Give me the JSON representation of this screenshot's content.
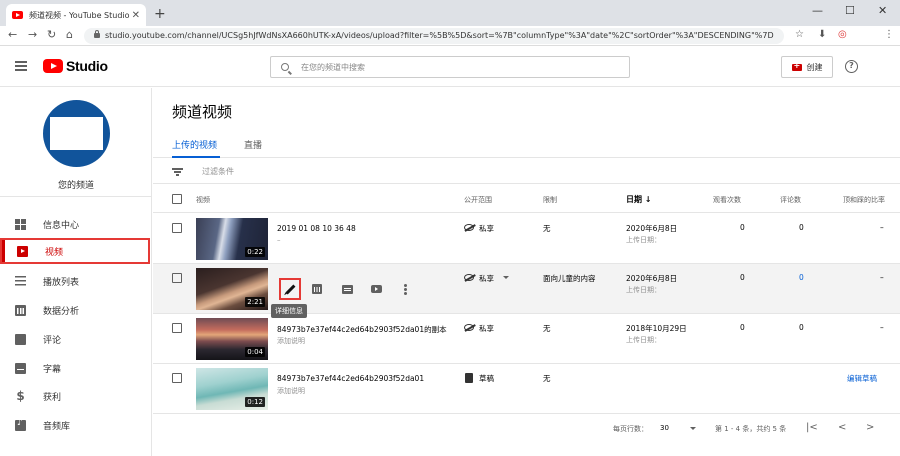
{
  "browser": {
    "tab_title": "频道视频 - YouTube Studio",
    "new_tab": "+",
    "url": "studio.youtube.com/channel/UCSg5hJfWdNsXA660hUTK-xA/videos/upload?filter=%5B%5D&sort=%7B\"columnType\"%3A\"date\"%2C\"sortOrder\"%3A\"DESCENDING\"%7D",
    "back": "←",
    "forward": "→",
    "reload": "↻",
    "home": "⌂",
    "minimize": "—",
    "maximize": "☐",
    "close": "✕",
    "star": "☆",
    "download": "⬇",
    "menu": "⋮"
  },
  "header": {
    "logo": "Studio",
    "search_placeholder": "在您的频道中搜索",
    "create_label": "创建",
    "help": "?"
  },
  "sidebar": {
    "channel_name": "您的频道",
    "items": [
      {
        "label": "信息中心",
        "icon": "dashboard-icon"
      },
      {
        "label": "视频",
        "icon": "video-icon",
        "active": true
      },
      {
        "label": "播放列表",
        "icon": "playlist-icon"
      },
      {
        "label": "数据分析",
        "icon": "analytics-icon"
      },
      {
        "label": "评论",
        "icon": "comment-icon"
      },
      {
        "label": "字幕",
        "icon": "subtitle-icon"
      },
      {
        "label": "获利",
        "icon": "dollar-icon"
      },
      {
        "label": "音频库",
        "icon": "audio-library-icon"
      }
    ]
  },
  "main": {
    "title": "频道视频",
    "tabs": [
      {
        "label": "上传的视频",
        "active": true
      },
      {
        "label": "直播"
      }
    ],
    "filter_placeholder": "过滤条件",
    "columns": {
      "video": "视频",
      "visibility": "公开范围",
      "restrictions": "限制",
      "date": "日期",
      "sort_arrow": "↓",
      "views": "观看次数",
      "comments": "评论数",
      "likes": "顶和踩的比率"
    },
    "rows": [
      {
        "title": "2019 01 08 10 36 48",
        "description": "–",
        "duration": "0:22",
        "visibility": "私享",
        "restriction": "无",
        "date": "2020年6月8日",
        "date_sub": "上传日期：",
        "views": "0",
        "comments": "0",
        "likes": "–"
      },
      {
        "title": "",
        "description": "",
        "duration": "2:21",
        "visibility": "私享",
        "restriction": "面向儿童的内容",
        "date": "2020年6月8日",
        "date_sub": "上传日期：",
        "views": "0",
        "comments": "0",
        "likes": "–",
        "tooltip": "详细信息"
      },
      {
        "title": "84973b7e37ef44c2ed64b2903f52da01的副本",
        "description": "添加说明",
        "duration": "0:04",
        "visibility": "私享",
        "restriction": "无",
        "date": "2018年10月29日",
        "date_sub": "上传日期：",
        "views": "0",
        "comments": "0",
        "likes": "–"
      },
      {
        "title": "84973b7e37ef44c2ed64b2903f52da01",
        "description": "添加说明",
        "duration": "0:12",
        "visibility": "草稿",
        "restriction": "无",
        "date": "",
        "date_sub": "",
        "views": "",
        "comments": "",
        "likes": "",
        "action": "编辑草稿"
      }
    ],
    "pagination": {
      "rows_per_page_label": "每页行数：",
      "rows_per_page": "30",
      "range": "第 1 - 4 条，共约 5 条",
      "first": "|<",
      "prev": "<",
      "next": ">"
    }
  },
  "colors": {
    "accent": "#065fd4",
    "brand": "#ff0000",
    "highlight": "#e53935"
  }
}
